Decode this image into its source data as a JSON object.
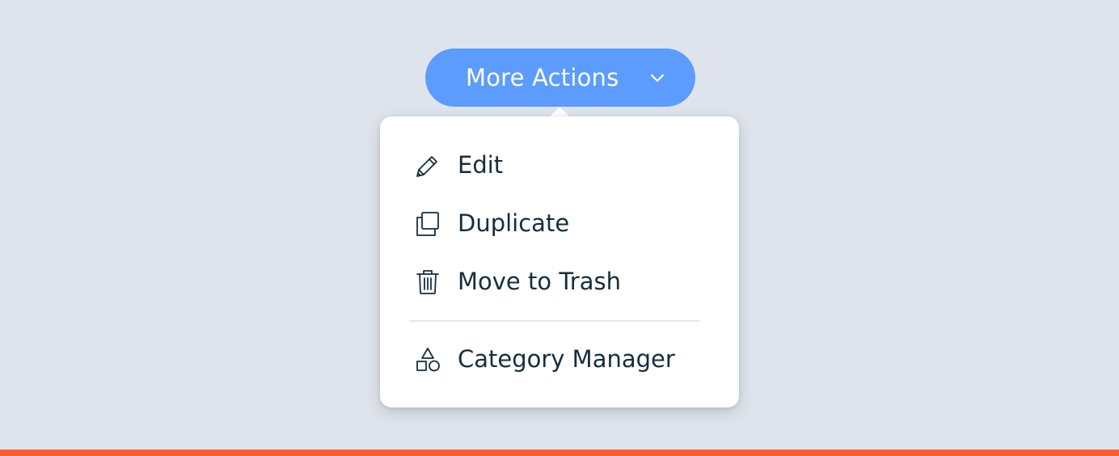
{
  "trigger": {
    "label": "More Actions",
    "chevron_icon": "chevron-down-icon",
    "color": "#5c9cff"
  },
  "menu": {
    "items": [
      {
        "label": "Edit",
        "icon": "pencil-icon"
      },
      {
        "label": "Duplicate",
        "icon": "duplicate-icon"
      },
      {
        "label": "Move to Trash",
        "icon": "trash-icon"
      },
      {
        "label": "Category Manager",
        "icon": "shapes-icon"
      }
    ]
  },
  "colors": {
    "background": "#dfe4ec",
    "menu_background": "#ffffff",
    "text": "#162d3d",
    "accent_strip": "#fb5e2e"
  }
}
